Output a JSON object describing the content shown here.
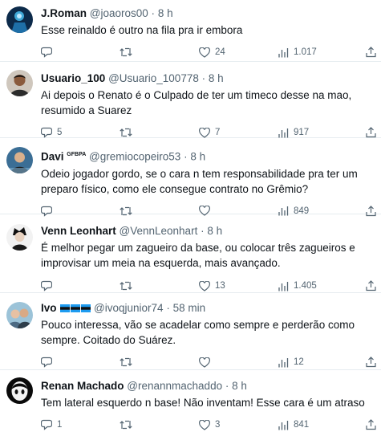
{
  "tweets": [
    {
      "name": "J.Roman",
      "handle": "@joaoros00",
      "time": "8 h",
      "text": "Esse reinaldo é outro na fila pra ir embora",
      "replies": "",
      "retweets": "",
      "likes": "24",
      "views": "1.017"
    },
    {
      "name": "Usuario_100",
      "handle": "@Usuario_100778",
      "time": "8 h",
      "text": "Ai depois o Renato é o Culpado de ter um timeco desse na mao, resumido a Suarez",
      "replies": "5",
      "retweets": "",
      "likes": "7",
      "views": "917"
    },
    {
      "name": "Davi",
      "badge": "GFBPA",
      "handle": "@gremiocopeiro53",
      "time": "8 h",
      "text": "Odeio jogador gordo, se o cara n tem responsabilidade pra ter um preparo físico, como ele consegue contrato no Grêmio?",
      "replies": "",
      "retweets": "",
      "likes": "",
      "views": "849"
    },
    {
      "name": "Venn Leonhart",
      "handle": "@VennLeonhart",
      "time": "8 h",
      "text": "É melhor pegar um zagueiro da base, ou colocar três zagueiros e improvisar um meia na esquerda, mais avançado.",
      "replies": "",
      "retweets": "",
      "likes": "13",
      "views": "1.405"
    },
    {
      "name": "Ivo",
      "handle": "@ivoqjunior74",
      "time": "58 min",
      "text": "Pouco interessa, vão se acadelar como sempre e perderão como sempre. Coitado do Suárez.",
      "replies": "",
      "retweets": "",
      "likes": "",
      "views": "12"
    },
    {
      "name": "Renan Machado",
      "handle": "@renannmachaddo",
      "time": "8 h",
      "text": "Tem lateral esquerdo n base! Não inventam! Esse cara é um atraso",
      "replies": "1",
      "retweets": "",
      "likes": "3",
      "views": "841"
    }
  ],
  "separator": "·",
  "colors": {
    "text": "#0f1419",
    "secondary": "#536471",
    "divider": "#e6ecf0",
    "flag": "#1d9bf0"
  },
  "icons": [
    "reply-icon",
    "retweet-icon",
    "like-icon",
    "views-icon",
    "share-icon"
  ]
}
